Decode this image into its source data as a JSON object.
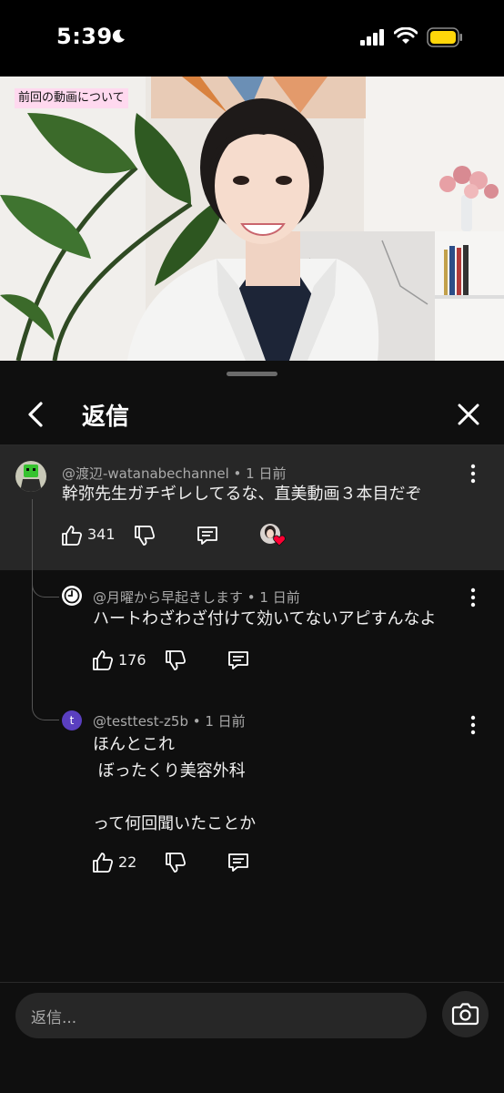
{
  "status_bar": {
    "time": "5:39"
  },
  "video": {
    "caption": "前回の動画について"
  },
  "header": {
    "title": "返信"
  },
  "comments": [
    {
      "author": "@渡辺-watanabechannel",
      "time": "1 日前",
      "text": "幹弥先生ガチギレしてるな、直美動画３本目だぞ",
      "likes": "341"
    },
    {
      "author": "@月曜から早起きします",
      "time": "1 日前",
      "text": "ハートわざわざ付けて効いてないアピすんなよ",
      "likes": "176"
    },
    {
      "author": "@testtest-z5b",
      "time": "1 日前",
      "avatar_letter": "t",
      "text": "ほんとこれ\n ぼったくり美容外科\n\nって何回聞いたことか",
      "likes": "22"
    }
  ],
  "reply_box": {
    "placeholder": "返信..."
  },
  "colors": {
    "background": "#0f0f0f",
    "highlight": "#272727",
    "avatar_purple": "#5a3fc0",
    "battery": "#ffd60a",
    "heart": "#ff0033"
  },
  "icons": [
    "moon-icon",
    "signal-icon",
    "wifi-icon",
    "battery-icon",
    "back-arrow-icon",
    "close-icon",
    "thumbs-up-icon",
    "thumbs-down-icon",
    "reply-icon",
    "more-vert-icon",
    "camera-icon",
    "heart-icon",
    "clock-icon"
  ]
}
